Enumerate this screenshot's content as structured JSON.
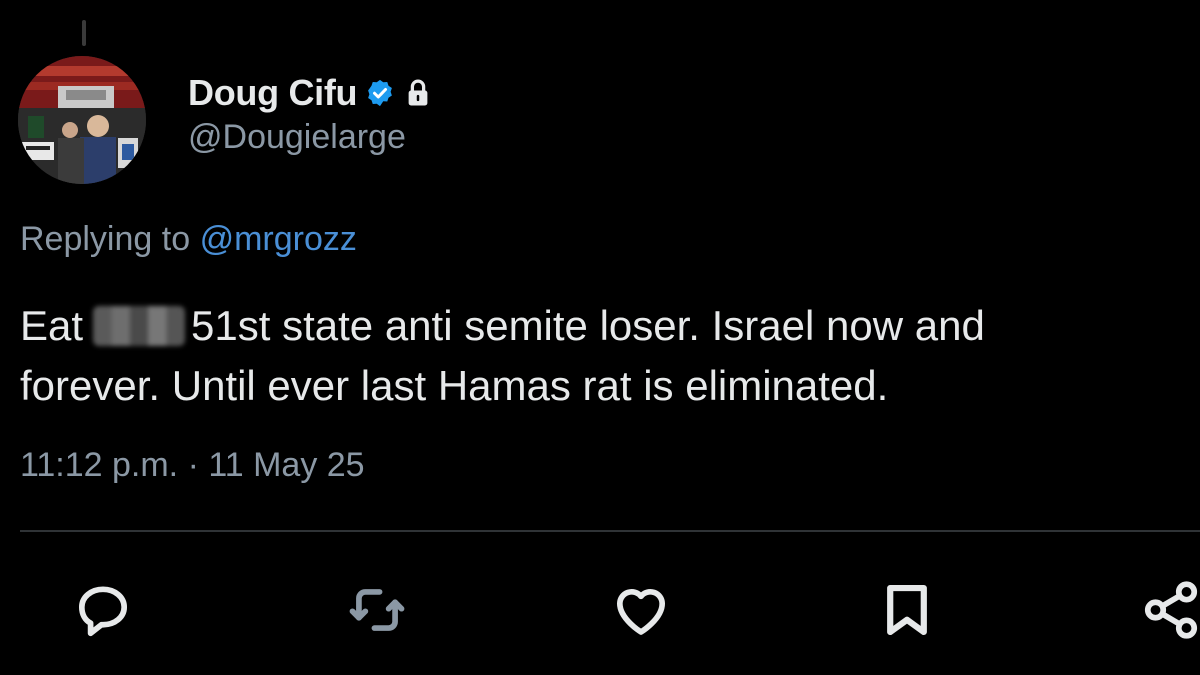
{
  "tweet": {
    "author": {
      "display_name": "Doug Cifu",
      "handle": "@Dougielarge",
      "verified": true,
      "protected": true,
      "avatar": "profile-photo"
    },
    "reply": {
      "prefix": "Replying to",
      "mention": "@mrgrozz"
    },
    "text": {
      "line1_start": "Eat",
      "censored": "[blurred]",
      "line1_rest": "51st state anti semite loser.  Israel now and",
      "line2": "forever.  Until ever last Hamas rat is eliminated."
    },
    "timestamp": "11:12 p.m. · 11 May 25"
  },
  "actions": [
    {
      "name": "reply",
      "icon": "reply-icon"
    },
    {
      "name": "repost",
      "icon": "repost-icon"
    },
    {
      "name": "like",
      "icon": "heart-icon"
    },
    {
      "name": "bookmark",
      "icon": "bookmark-icon"
    },
    {
      "name": "share",
      "icon": "share-icon"
    }
  ],
  "colors": {
    "background": "#000000",
    "text_primary": "#e7e9ea",
    "text_secondary": "#8b98a5",
    "link": "#4a8fd6",
    "verified_badge": "#1d9bf0",
    "divider": "#2f3336",
    "icon": "#e7e9ea"
  }
}
